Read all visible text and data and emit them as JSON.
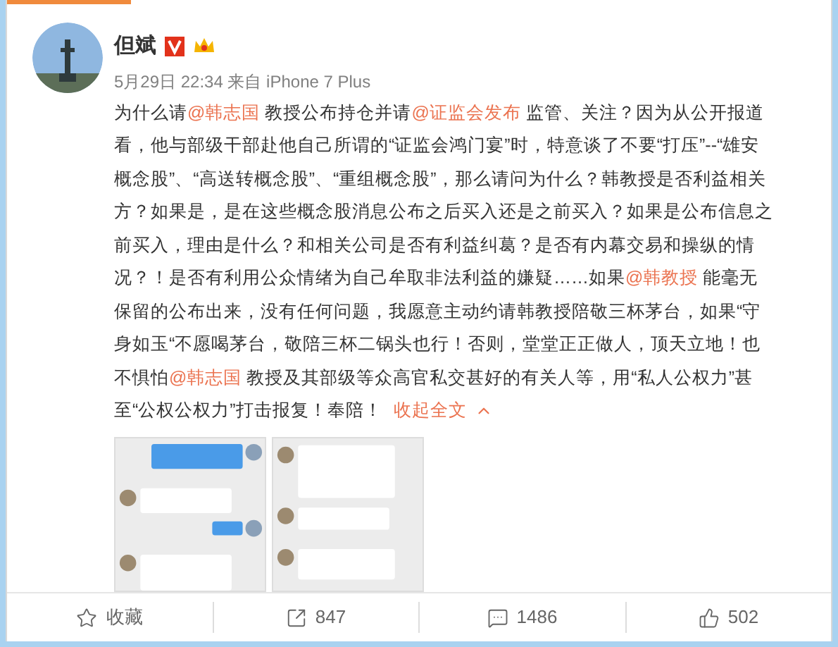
{
  "author": {
    "name": "但斌",
    "verified": true,
    "meta": "5月29日 22:34 来自 iPhone 7 Plus"
  },
  "post": {
    "segments": [
      {
        "kind": "text",
        "text": "为什么请"
      },
      {
        "kind": "mention",
        "text": "@韩志国"
      },
      {
        "kind": "text",
        "text": " 教授公布持仓并请"
      },
      {
        "kind": "mention",
        "text": "@证监会发布"
      },
      {
        "kind": "text",
        "text": " 监管、关注？因为从公开报道看，他与部级干部赴他自己所谓的“证监会鸿门宴”时，特意谈了不要“打压”--“雄安概念股”、“高送转概念股”、“重组概念股”，那么请问为什么？韩教授是否利益相关方？如果是，是在这些概念股消息公布之后买入还是之前买入？如果是公布信息之前买入，理由是什么？和相关公司是否有利益纠葛？是否有内幕交易和操纵的情况？！是否有利用公众情绪为自己牟取非法利益的嫌疑……如果"
      },
      {
        "kind": "mention",
        "text": "@韩教授"
      },
      {
        "kind": "text",
        "text": " 能毫无保留的公布出来，没有任何问题，我愿意主动约请韩教授陪敬三杯茅台，如果“守身如玉“不愿喝茅台，敬陪三杯二锅头也行！否则，堂堂正正做人，顶天立地！也不惧怕"
      },
      {
        "kind": "mention",
        "text": "@韩志国"
      },
      {
        "kind": "text",
        "text": " 教授及其部级等众高官私交甚好的有关人等，用“私人公权力”甚至“公权公权力”打击报复！奉陪！"
      }
    ],
    "collapse_link": "收起全文"
  },
  "actions": [
    {
      "kind": "favorite",
      "label": "收藏"
    },
    {
      "kind": "repost",
      "label": "847"
    },
    {
      "kind": "comment",
      "label": "1486"
    },
    {
      "kind": "like",
      "label": "502"
    }
  ]
}
